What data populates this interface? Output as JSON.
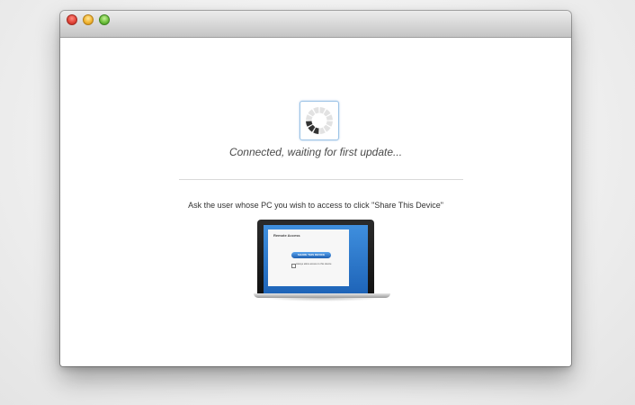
{
  "status": {
    "message": "Connected, waiting for first update..."
  },
  "instructions": {
    "text": "Ask the user whose PC you wish to access to click \"Share This Device\""
  },
  "illustration": {
    "window_title": "Remote Access",
    "share_button_label": "SHARE THIS DEVICE",
    "checkbox_label": "Always allow access to this device"
  },
  "colors": {
    "spinner_active": "#333333",
    "spinner_inactive": "#e2e2e2",
    "spinner_border": "#9cc3e6",
    "laptop_screen": "#2f7fd4"
  }
}
